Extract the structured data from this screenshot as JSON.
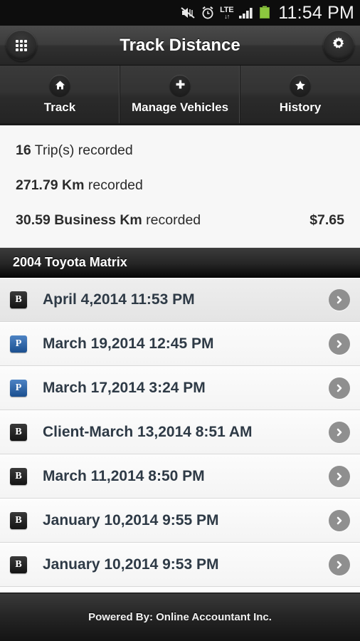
{
  "status_bar": {
    "time": "11:54 PM",
    "icons": [
      {
        "name": "mute-vibrate-icon"
      },
      {
        "name": "alarm-clock-icon"
      },
      {
        "name": "lte-data-icon",
        "label": "LTE",
        "arrows": "↓↑"
      },
      {
        "name": "signal-bars-icon"
      },
      {
        "name": "battery-icon",
        "color": "#8CC63F"
      }
    ]
  },
  "action_bar": {
    "title": "Track Distance",
    "left_button": "app-drawer-grid-icon",
    "right_button": "settings-gear-icon"
  },
  "tabs": [
    {
      "label": "Track",
      "icon": "home-icon"
    },
    {
      "label": "Manage Vehicles",
      "icon": "plus-icon"
    },
    {
      "label": "History",
      "icon": "star-icon"
    }
  ],
  "stats": [
    {
      "value": "16",
      "label": " Trip(s) recorded",
      "amount": ""
    },
    {
      "value": "271.79 Km",
      "label": " recorded",
      "amount": ""
    },
    {
      "value": "30.59 Business Km",
      "label": " recorded",
      "amount": "$7.65"
    }
  ],
  "vehicle": {
    "name": "2004 Toyota Matrix"
  },
  "trips": [
    {
      "badge": "B",
      "type": "business",
      "label": "April 4,2014 11:53 PM",
      "selected": true
    },
    {
      "badge": "P",
      "type": "personal",
      "label": "March 19,2014 12:45 PM",
      "selected": false
    },
    {
      "badge": "P",
      "type": "personal",
      "label": "March 17,2014 3:24 PM",
      "selected": false
    },
    {
      "badge": "B",
      "type": "business",
      "label": "Client-March 13,2014 8:51 AM",
      "selected": false
    },
    {
      "badge": "B",
      "type": "business",
      "label": "March 11,2014 8:50 PM",
      "selected": false
    },
    {
      "badge": "B",
      "type": "business",
      "label": "January 10,2014 9:55 PM",
      "selected": false
    },
    {
      "badge": "B",
      "type": "business",
      "label": "January 10,2014 9:53 PM",
      "selected": false
    }
  ],
  "footer": {
    "text": "Powered By: Online Accountant Inc."
  },
  "colors": {
    "accent_blue": "#1b4f8f",
    "battery_green": "#8CC63F",
    "row_text": "#2e3a46"
  }
}
